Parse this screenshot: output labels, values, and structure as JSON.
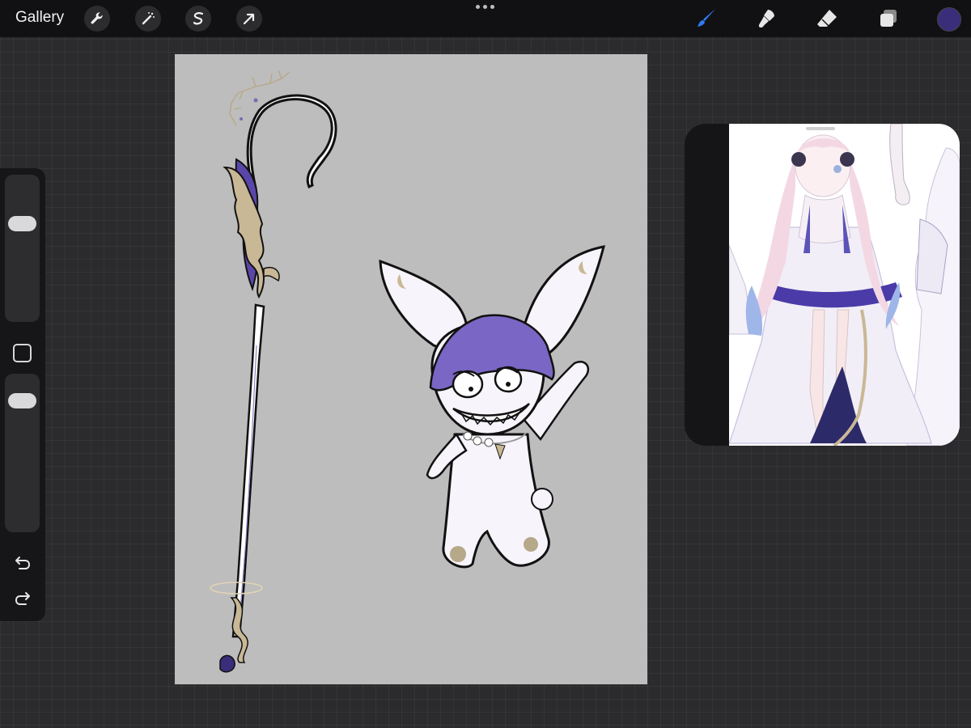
{
  "topbar": {
    "gallery_label": "Gallery",
    "left_tools": [
      "wrench-icon",
      "magic-wand-icon",
      "selection-icon",
      "transform-arrow-icon"
    ],
    "right_tools": [
      "brush-icon",
      "smudge-icon",
      "eraser-icon",
      "layers-icon"
    ],
    "active_tool": "brush-icon",
    "active_color": "#3a2d7a",
    "accent_color": "#2f7bf6"
  },
  "sidebar": {
    "brush_size": 0.7,
    "opacity": 0.88,
    "icons": [
      "modify-button",
      "undo-icon",
      "redo-icon"
    ]
  },
  "canvas": {
    "background": "#bdbdbd",
    "artwork": [
      "staff-drawing",
      "bunny-creature-drawing"
    ]
  },
  "reference": {
    "panel": "reference-window",
    "image": "character-reference-sheet"
  }
}
